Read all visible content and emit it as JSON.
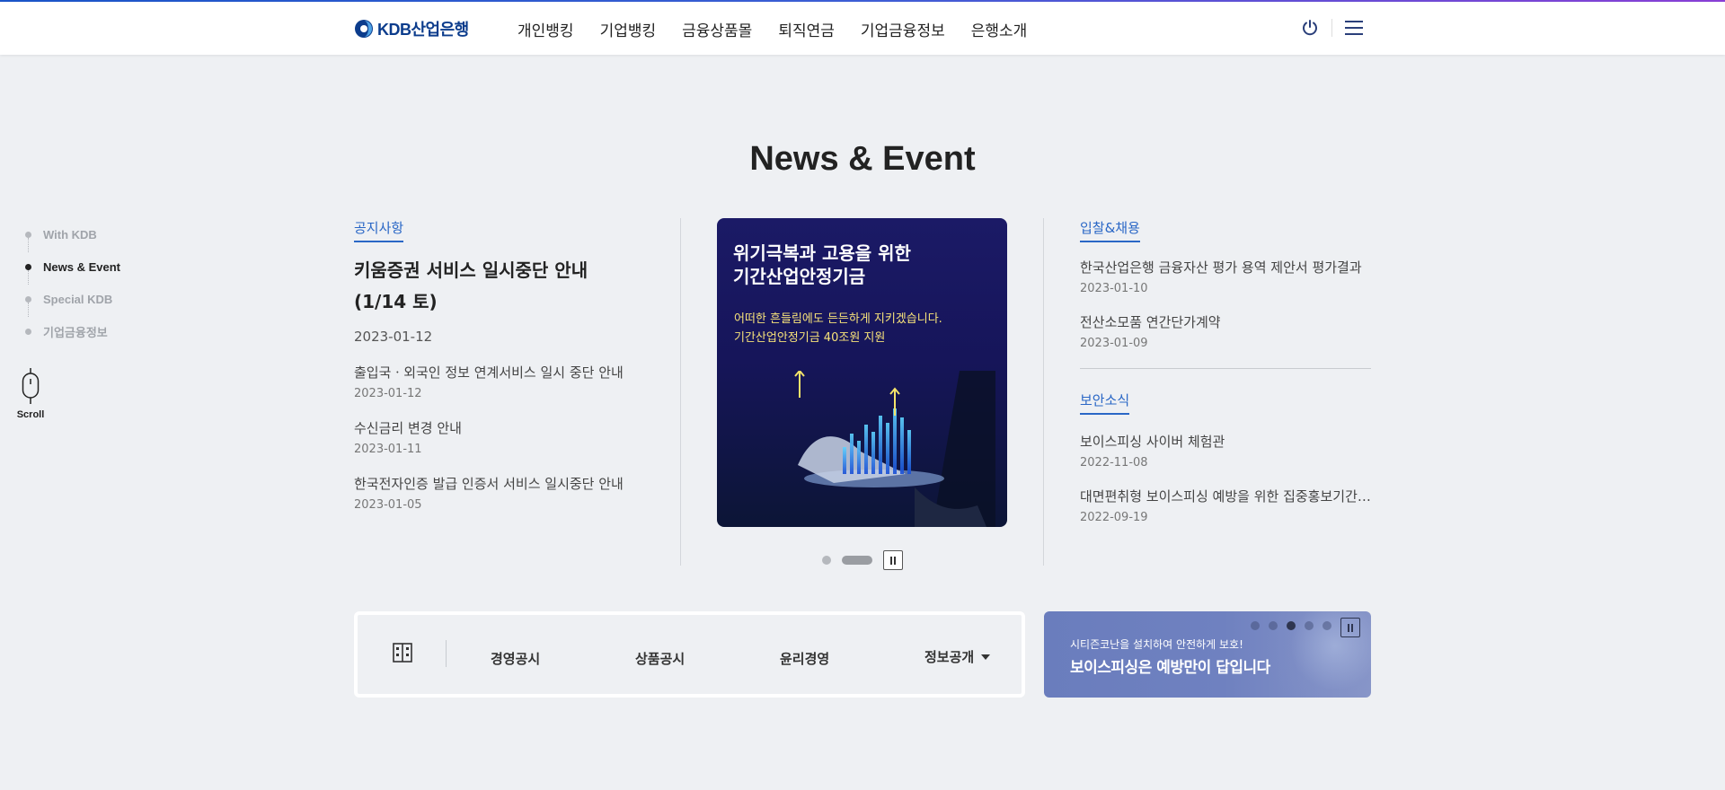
{
  "header": {
    "logo_text": "KDB산업은행",
    "nav": [
      "개인뱅킹",
      "기업뱅킹",
      "금융상품몰",
      "퇴직연금",
      "기업금융정보",
      "은행소개"
    ]
  },
  "section_title": "News & Event",
  "side_nav": {
    "items": [
      "With KDB",
      "News & Event",
      "Special KDB",
      "기업금융정보"
    ],
    "active_index": 1,
    "scroll_label": "Scroll"
  },
  "notice": {
    "tag": "공지사항",
    "featured": {
      "title": "키움증권 서비스 일시중단 안내(1/14 토)",
      "date": "2023-01-12"
    },
    "items": [
      {
        "title": "출입국ㆍ외국인 정보 연계서비스 일시 중단 안내",
        "date": "2023-01-12"
      },
      {
        "title": "수신금리 변경 안내",
        "date": "2023-01-11"
      },
      {
        "title": "한국전자인증 발급 인증서 서비스 일시중단 안내",
        "date": "2023-01-05"
      }
    ]
  },
  "banner": {
    "headline_1": "위기극복과 고용을 위한",
    "headline_2": "기간산업안정기금",
    "sub_1": "어떠한 흔들림에도 든든하게 지키겠습니다.",
    "sub_2": "기간산업안정기금 40조원 지원",
    "slide_count": 2,
    "active_slide": 2
  },
  "bid": {
    "tag": "입찰&채용",
    "items": [
      {
        "title": "한국산업은행 금융자산 평가 용역 제안서 평가결과",
        "date": "2023-01-10"
      },
      {
        "title": "전산소모품 연간단가계약",
        "date": "2023-01-09"
      }
    ]
  },
  "security": {
    "tag": "보안소식",
    "items": [
      {
        "title": "보이스피싱 사이버 체험관",
        "date": "2022-11-08"
      },
      {
        "title": "대면편취형 보이스피싱 예방을 위한 집중홍보기간 운영",
        "date": "2022-09-19"
      }
    ]
  },
  "disclosure": {
    "links": [
      "경영공시",
      "상품공시",
      "윤리경영"
    ],
    "select_label": "정보공개"
  },
  "phishing": {
    "small": "시티즌코난을 설치하여 안전하게 보호!",
    "big": "보이스피싱은 예방만이 답입니다",
    "slide_count": 5,
    "active_slide": 3
  }
}
